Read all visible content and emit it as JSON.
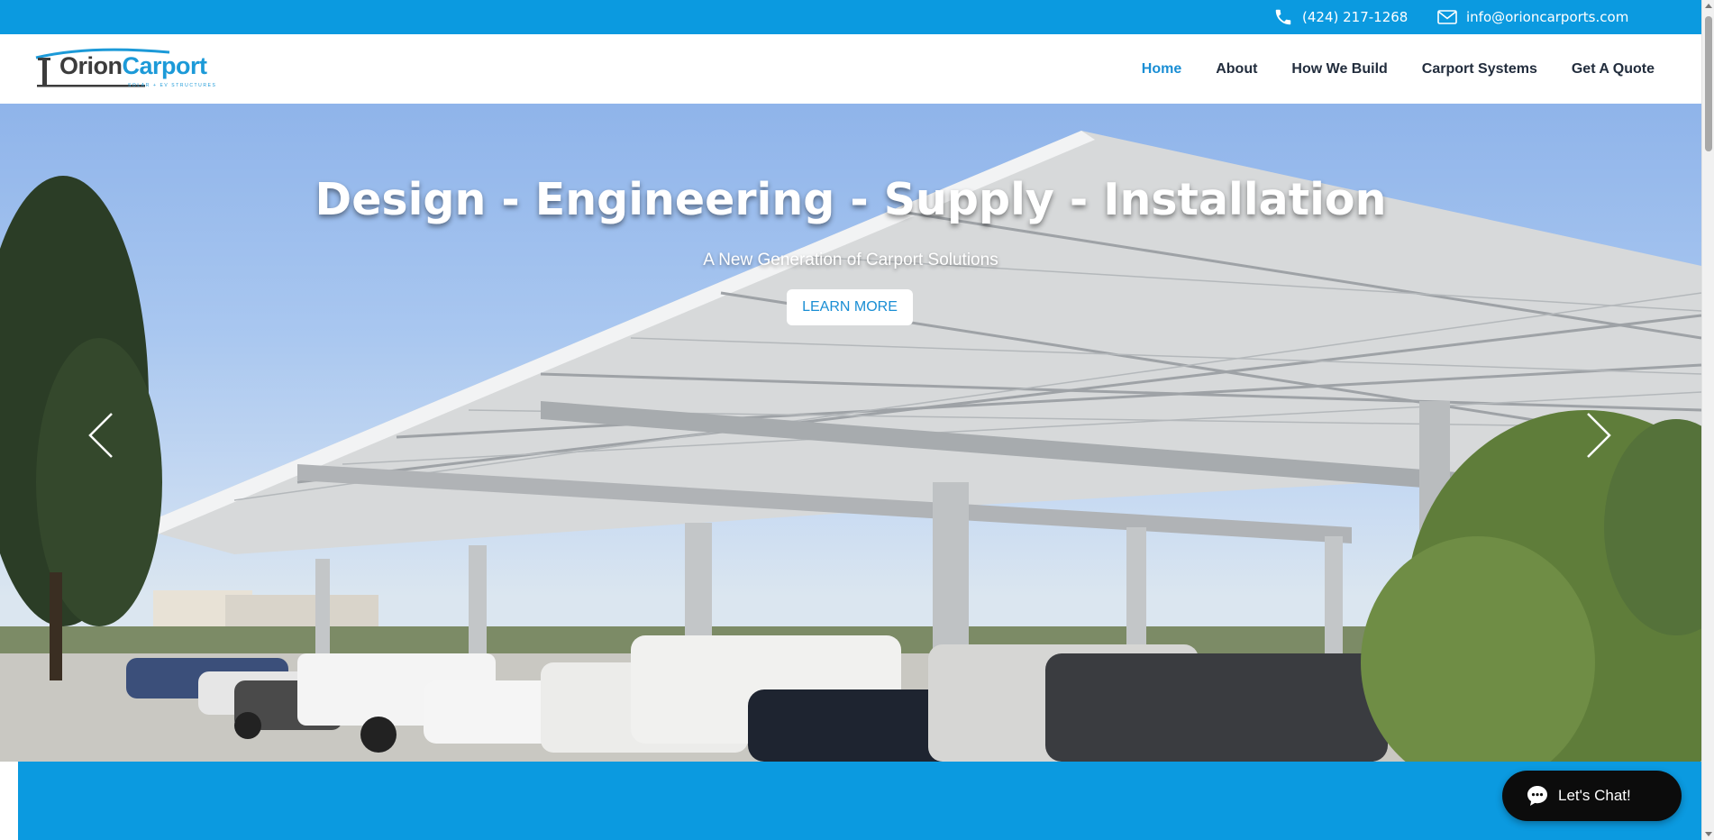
{
  "colors": {
    "brand_blue": "#0b9ae0",
    "nav_active": "#1a8ed4",
    "nav_text": "#222d3d",
    "chat_bg": "#0c0c0c"
  },
  "topbar": {
    "phone": "(424) 217-1268",
    "email": "info@orioncarports.com",
    "phone_icon": "phone-icon",
    "email_icon": "mail-icon"
  },
  "header": {
    "logo": {
      "word1": "Orion",
      "word2": "Carport",
      "tagline": "SOLAR + EV STRUCTURES"
    },
    "nav": [
      {
        "label": "Home",
        "active": true
      },
      {
        "label": "About"
      },
      {
        "label": "How We Build"
      },
      {
        "label": "Carport Systems"
      },
      {
        "label": "Get A Quote"
      }
    ]
  },
  "hero": {
    "title": "Design - Engineering - Supply - Installation",
    "subtitle": "A New Generation of Carport Solutions",
    "button_label": "LEARN MORE",
    "prev_icon": "chevron-left-icon",
    "next_icon": "chevron-right-icon"
  },
  "chat": {
    "label": "Let's Chat!",
    "icon": "chat-bubble-icon"
  }
}
